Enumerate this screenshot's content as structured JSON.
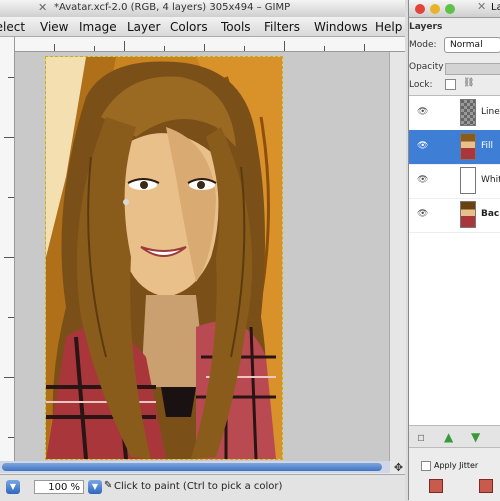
{
  "main_window": {
    "title": "*Avatar.xcf-2.0 (RGB, 4 layers) 305x494 – GIMP",
    "menu": [
      "Select",
      "View",
      "Image",
      "Layer",
      "Colors",
      "Tools",
      "Filters",
      "Windows",
      "Help"
    ],
    "status": {
      "zoom_value": "100 %",
      "message": "Click to paint (Ctrl to pick a color)"
    }
  },
  "layers_window": {
    "title": "La",
    "header": "Layers",
    "mode_label": "Mode:",
    "mode_value": "Normal",
    "opacity_label": "Opacity",
    "lock_label": "Lock:",
    "layers": [
      {
        "name": "Line",
        "thumb": "checker",
        "selected": false
      },
      {
        "name": "Fill",
        "thumb": "portrait",
        "selected": true
      },
      {
        "name": "White",
        "thumb": "white",
        "selected": false
      },
      {
        "name": "Backg",
        "thumb": "portrait",
        "selected": false
      }
    ],
    "tool_options": {
      "apply_jitter_label": "Apply Jitter"
    }
  },
  "colors": {
    "selection": "#3e7fd5",
    "scroll_thumb": "#3f74c3",
    "canvas_bg": "#c9c9c9"
  }
}
